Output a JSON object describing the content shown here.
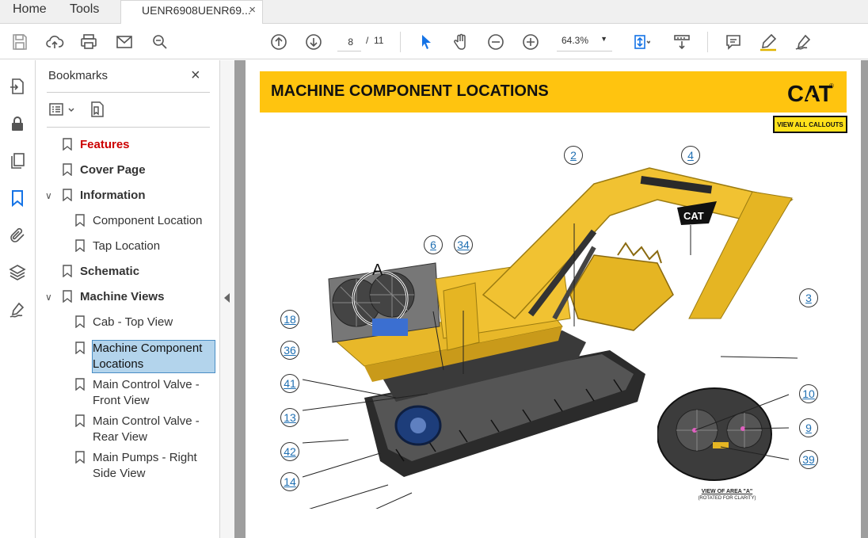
{
  "tabs": {
    "home": "Home",
    "tools": "Tools",
    "document": "UENR6908UENR69...",
    "close": "×"
  },
  "toolbar": {
    "page_current": "8",
    "page_separator": "/",
    "page_total": "11",
    "zoom": "64.3%"
  },
  "bookmarks": {
    "title": "Bookmarks",
    "close": "×",
    "items": [
      {
        "label": "Features",
        "level": 0,
        "bold": true,
        "color": "#cc0000"
      },
      {
        "label": "Cover Page",
        "level": 0,
        "bold": true
      },
      {
        "label": "Information",
        "level": 0,
        "bold": true,
        "expanded": true
      },
      {
        "label": "Component Location",
        "level": 1
      },
      {
        "label": "Tap Location",
        "level": 1
      },
      {
        "label": "Schematic",
        "level": 0,
        "bold": true
      },
      {
        "label": "Machine Views",
        "level": 0,
        "bold": true,
        "expanded": true
      },
      {
        "label": "Cab - Top View",
        "level": 1
      },
      {
        "label": "Machine Component Locations",
        "level": 1,
        "selected": true
      },
      {
        "label": "Main Control Valve - Front View",
        "level": 1
      },
      {
        "label": "Main Control Valve - Rear View",
        "level": 1
      },
      {
        "label": "Main Pumps - Right Side View",
        "level": 1
      }
    ]
  },
  "page": {
    "title": "MACHINE COMPONENT LOCATIONS",
    "brand": "CAT",
    "view_all": "VIEW ALL CALLOUTS",
    "area_label": "A",
    "view_caption": "VIEW OF AREA \"A\"",
    "view_caption_sub": "(ROTATED FOR CLARITY)",
    "callouts": [
      "2",
      "4",
      "6",
      "34",
      "3",
      "18",
      "36",
      "41",
      "13",
      "42",
      "14",
      "10",
      "9",
      "39"
    ]
  },
  "colors": {
    "banner": "#ffc40f",
    "accent_blue": "#1473e6",
    "selection": "#b3d4ec",
    "machine_yellow": "#f1c232",
    "callout": "#1f6fb2"
  }
}
